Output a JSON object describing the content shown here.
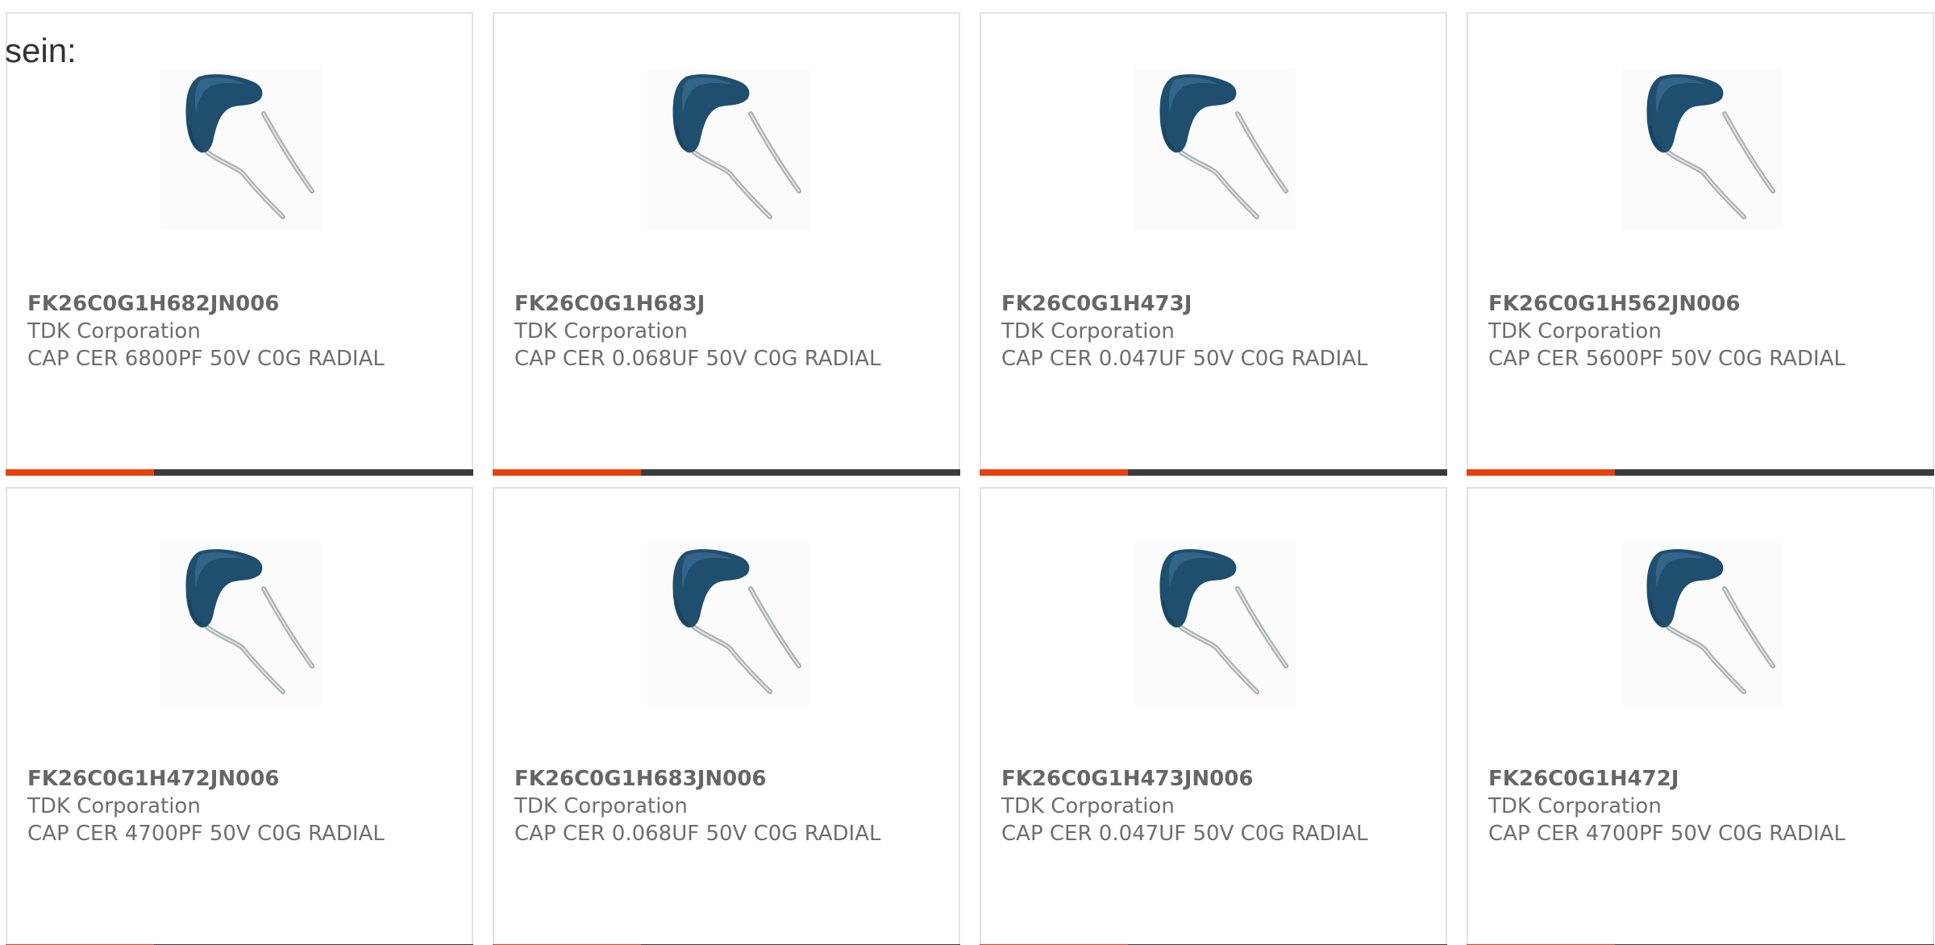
{
  "intro_text": "sein:",
  "colors": {
    "accent": "#e8410e",
    "bar_dark": "#3b3b3b",
    "card_border": "#e2e2e2",
    "text": "#6e6e6e",
    "capacitor_body": "#1f4e6e"
  },
  "product_image_icon": "radial-ceramic-capacitor",
  "products": [
    {
      "part_number": "FK26C0G1H682JN006",
      "manufacturer": "TDK Corporation",
      "description": "CAP CER 6800PF 50V C0G RADIAL"
    },
    {
      "part_number": "FK26C0G1H683J",
      "manufacturer": "TDK Corporation",
      "description": "CAP CER 0.068UF 50V C0G RADIAL"
    },
    {
      "part_number": "FK26C0G1H473J",
      "manufacturer": "TDK Corporation",
      "description": "CAP CER 0.047UF 50V C0G RADIAL"
    },
    {
      "part_number": "FK26C0G1H562JN006",
      "manufacturer": "TDK Corporation",
      "description": "CAP CER 5600PF 50V C0G RADIAL"
    },
    {
      "part_number": "FK26C0G1H472JN006",
      "manufacturer": "TDK Corporation",
      "description": "CAP CER 4700PF 50V C0G RADIAL"
    },
    {
      "part_number": "FK26C0G1H683JN006",
      "manufacturer": "TDK Corporation",
      "description": "CAP CER 0.068UF 50V C0G RADIAL"
    },
    {
      "part_number": "FK26C0G1H473JN006",
      "manufacturer": "TDK Corporation",
      "description": "CAP CER 0.047UF 50V C0G RADIAL"
    },
    {
      "part_number": "FK26C0G1H472J",
      "manufacturer": "TDK Corporation",
      "description": "CAP CER 4700PF 50V C0G RADIAL"
    }
  ]
}
